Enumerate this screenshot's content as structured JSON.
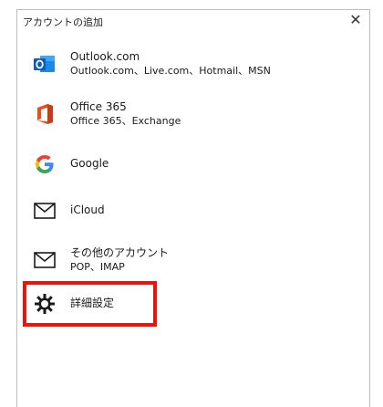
{
  "dialog": {
    "title": "アカウントの追加",
    "close_glyph": "✕"
  },
  "accounts": [
    {
      "name": "Outlook.com",
      "sub": "Outlook.com、Live.com、Hotmail、MSN",
      "icon": "outlook-icon"
    },
    {
      "name": "Office 365",
      "sub": "Office 365、Exchange",
      "icon": "office-365-icon"
    },
    {
      "name": "Google",
      "icon": "google-icon"
    },
    {
      "name": "iCloud",
      "icon": "mail-envelope-icon"
    },
    {
      "name": "その他のアカウント",
      "sub": "POP、IMAP",
      "icon": "mail-envelope-icon"
    },
    {
      "name": "詳細設定",
      "icon": "gear-icon"
    }
  ],
  "highlight": {
    "target": "詳細設定",
    "color": "#e8150e"
  }
}
